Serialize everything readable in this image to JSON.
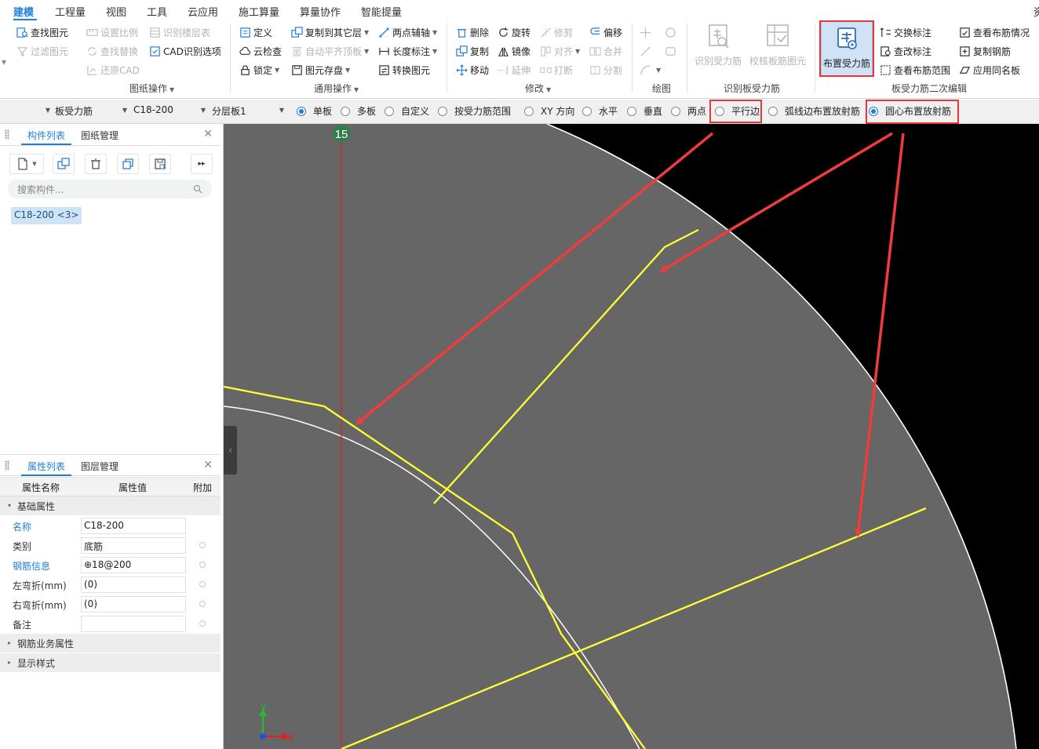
{
  "menu": {
    "items": [
      "建模",
      "工程量",
      "视图",
      "工具",
      "云应用",
      "施工算量",
      "算量协作",
      "智能提量"
    ],
    "active_index": 0,
    "edge_text": "资"
  },
  "ribbon": {
    "drawing_ops": {
      "find_element": "查找图元",
      "filter_element": "过滤图元",
      "set_scale": "设置比例",
      "find_replace": "查找替换",
      "restore_cad": "还原CAD",
      "identify_floor_table": "识别楼层表",
      "cad_options": "CAD识别选项",
      "group_label": "图纸操作"
    },
    "general_ops": {
      "define": "定义",
      "cloud_check": "云检查",
      "lock": "锁定",
      "copy_to_floor": "复制到其它层",
      "auto_align_slab": "自动平齐顶板",
      "element_save": "图元存盘",
      "two_point_axis": "两点辅轴",
      "length_dim": "长度标注",
      "convert_element": "转换图元",
      "group_label": "通用操作"
    },
    "modify": {
      "delete": "删除",
      "copy": "复制",
      "move": "移动",
      "rotate": "旋转",
      "mirror": "镜像",
      "extend": "延伸",
      "trim": "修剪",
      "align": "对齐",
      "break": "打断",
      "offset": "偏移",
      "merge": "合并",
      "split": "分割",
      "group_label": "修改"
    },
    "draw": {
      "group_label": "绘图"
    },
    "identify": {
      "identify_rebar": "识别受力筋",
      "check_slab_rebar": "校核板筋图元",
      "group_label": "识别板受力筋"
    },
    "secondary": {
      "layout_rebar": "布置受力筋",
      "swap_label": "交换标注",
      "edit_label": "查改标注",
      "view_layout_range": "查看布筋范围",
      "view_layout": "查看布筋情况",
      "copy_rebar": "复制钢筋",
      "apply_same_slab": "应用同名板",
      "group_label": "板受力筋二次编辑"
    }
  },
  "options": {
    "element_type": "板受力筋",
    "element_name": "C18-200",
    "layer": "分层板1",
    "radios": [
      "单板",
      "多板",
      "自定义",
      "按受力筋范围",
      "XY 方向",
      "水平",
      "垂直",
      "两点",
      "平行边",
      "弧线边布置放射筋",
      "圆心布置放射筋"
    ],
    "selected_radio": "单板",
    "selected_radio_2": "圆心布置放射筋"
  },
  "component_panel": {
    "tab_components": "构件列表",
    "tab_drawings": "图纸管理",
    "search_placeholder": "搜索构件...",
    "item": "C18-200 <3>"
  },
  "property_panel": {
    "tab_properties": "属性列表",
    "tab_layers": "图层管理",
    "col_name": "属性名称",
    "col_value": "属性值",
    "col_extra": "附加",
    "section_basic": "基础属性",
    "rows": [
      {
        "name": "名称",
        "value": "C18-200",
        "blue": true,
        "radio": false
      },
      {
        "name": "类别",
        "value": "底筋",
        "blue": false,
        "radio": true
      },
      {
        "name": "钢筋信息",
        "value": "⊕18@200",
        "blue": true,
        "radio": true
      },
      {
        "name": "左弯折(mm)",
        "value": "(0)",
        "blue": false,
        "radio": true
      },
      {
        "name": "右弯折(mm)",
        "value": "(0)",
        "blue": false,
        "radio": true
      },
      {
        "name": "备注",
        "value": "",
        "blue": false,
        "radio": true
      }
    ],
    "section_business": "钢筋业务属性",
    "section_display": "显示样式"
  },
  "canvas": {
    "axis_label": "15",
    "axis_x": "X",
    "axis_y": "Y",
    "colors": {
      "background": "#000000",
      "slab_fill": "#666666",
      "rebar_line": "#ffff33",
      "axis_line": "#e02020",
      "arrow": "#f03c3c"
    }
  }
}
